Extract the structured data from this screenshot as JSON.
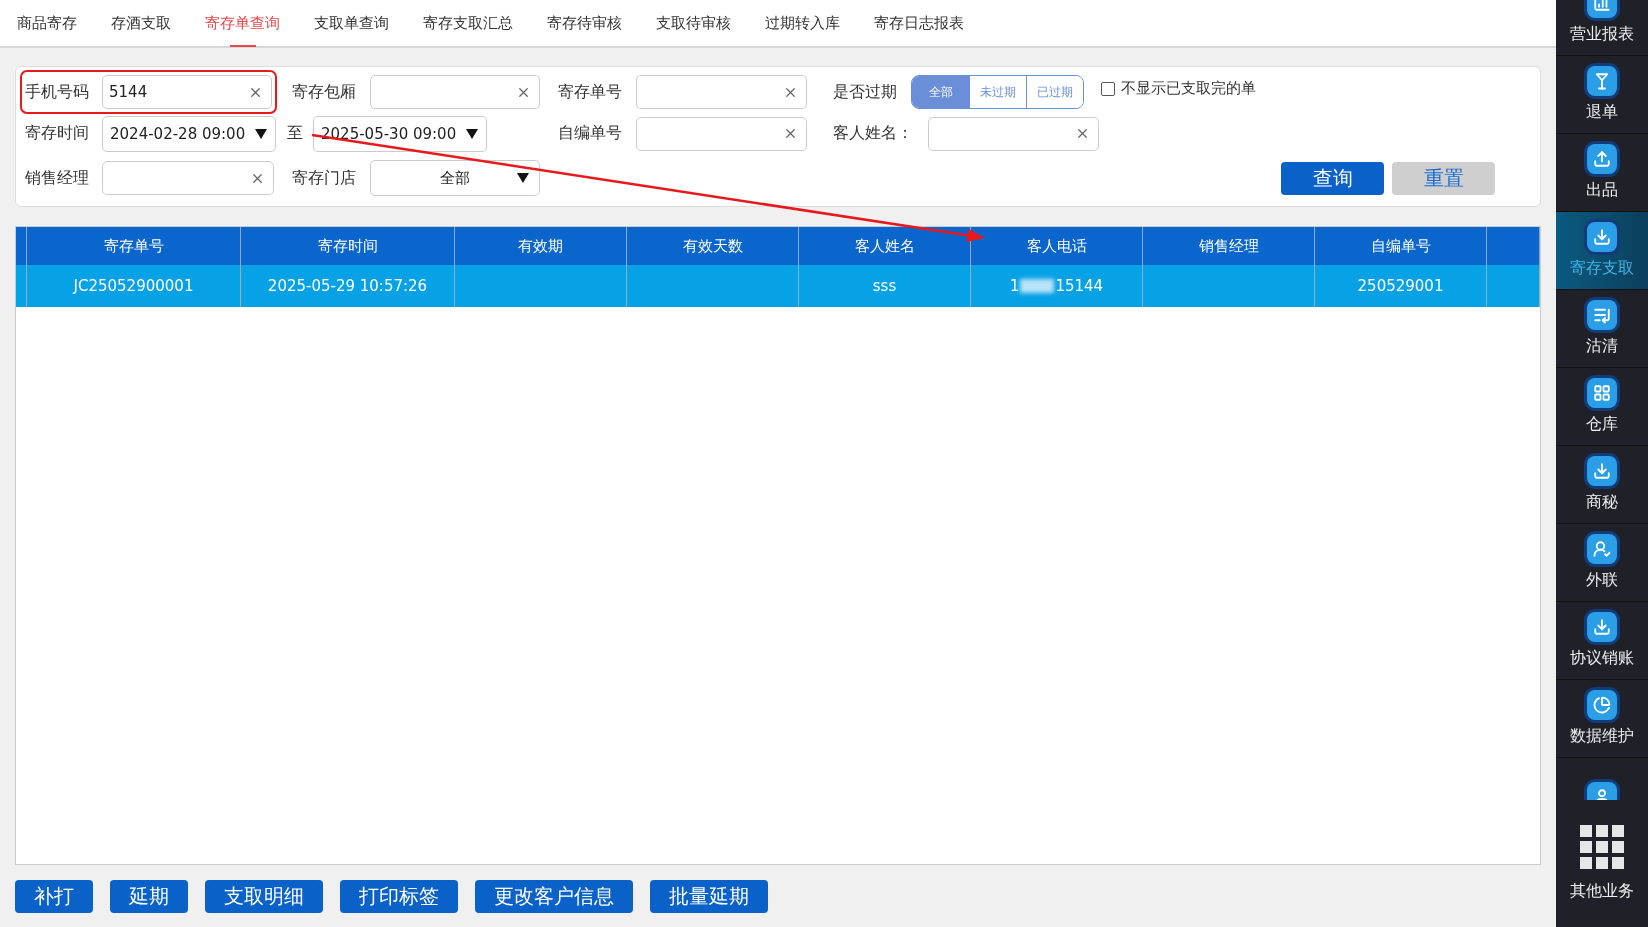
{
  "tabs": [
    {
      "label": "商品寄存",
      "selected": false
    },
    {
      "label": "存酒支取",
      "selected": false
    },
    {
      "label": "寄存单查询",
      "selected": true
    },
    {
      "label": "支取单查询",
      "selected": false
    },
    {
      "label": "寄存支取汇总",
      "selected": false
    },
    {
      "label": "寄存待审核",
      "selected": false
    },
    {
      "label": "支取待审核",
      "selected": false
    },
    {
      "label": "过期转入库",
      "selected": false
    },
    {
      "label": "寄存日志报表",
      "selected": false
    }
  ],
  "filters": {
    "phone": {
      "label": "手机号码",
      "value": "5144",
      "highlighted": true
    },
    "room": {
      "label": "寄存包厢"
    },
    "order_no": {
      "label": "寄存单号"
    },
    "expired": {
      "label": "是否过期",
      "options": [
        {
          "label": "全部",
          "selected": true
        },
        {
          "label": "未过期",
          "selected": false
        },
        {
          "label": "已过期",
          "selected": false
        }
      ]
    },
    "hide_done": {
      "label": "不显示已支取完的单",
      "checked": false
    },
    "time": {
      "label": "寄存时间",
      "from": "2024-02-28 09:00",
      "separator": "至",
      "to": "2025-05-30 09:00"
    },
    "custom_no": {
      "label": "自编单号"
    },
    "customer_name": {
      "label": "客人姓名："
    },
    "manager": {
      "label": "销售经理"
    },
    "store": {
      "label": "寄存门店",
      "value": "全部"
    }
  },
  "actions": [
    {
      "label": "查询",
      "kind": "primary"
    },
    {
      "label": "重置",
      "kind": "secondary"
    }
  ],
  "annotation_arrow": true,
  "table": {
    "columns": [
      "寄存单号",
      "寄存时间",
      "有效期",
      "有效天数",
      "客人姓名",
      "客人电话",
      "销售经理",
      "自编单号"
    ],
    "rows": [
      {
        "selected": true,
        "cells": [
          "JC25052900001",
          "2025-05-29 10:57:26",
          null,
          null,
          "sss",
          {
            "kind": "redacted",
            "start": "1",
            "end": "15144"
          },
          null,
          "250529001"
        ]
      }
    ]
  },
  "bottom_buttons": [
    "补打",
    "延期",
    "支取明细",
    "打印标签",
    "更改客户信息",
    "批量延期"
  ],
  "sidebar": {
    "items": [
      {
        "kind": "entry",
        "label": "营业报表",
        "selected": false
      },
      {
        "kind": "entry",
        "label": "退单",
        "selected": false
      },
      {
        "kind": "entry",
        "label": "出品",
        "selected": false
      },
      {
        "kind": "entry",
        "label": "寄存支取",
        "selected": true
      },
      {
        "kind": "entry",
        "label": "沽清",
        "selected": false
      },
      {
        "kind": "entry",
        "label": "仓库",
        "selected": false
      },
      {
        "kind": "entry",
        "label": "商秘",
        "selected": false
      },
      {
        "kind": "entry",
        "label": "外联",
        "selected": false
      },
      {
        "kind": "entry",
        "label": "协议销账",
        "selected": false
      },
      {
        "kind": "entry",
        "label": "数据维护",
        "selected": false
      },
      {
        "kind": "icon_only",
        "selected": false
      }
    ],
    "other": {
      "label": "其他业务"
    }
  }
}
